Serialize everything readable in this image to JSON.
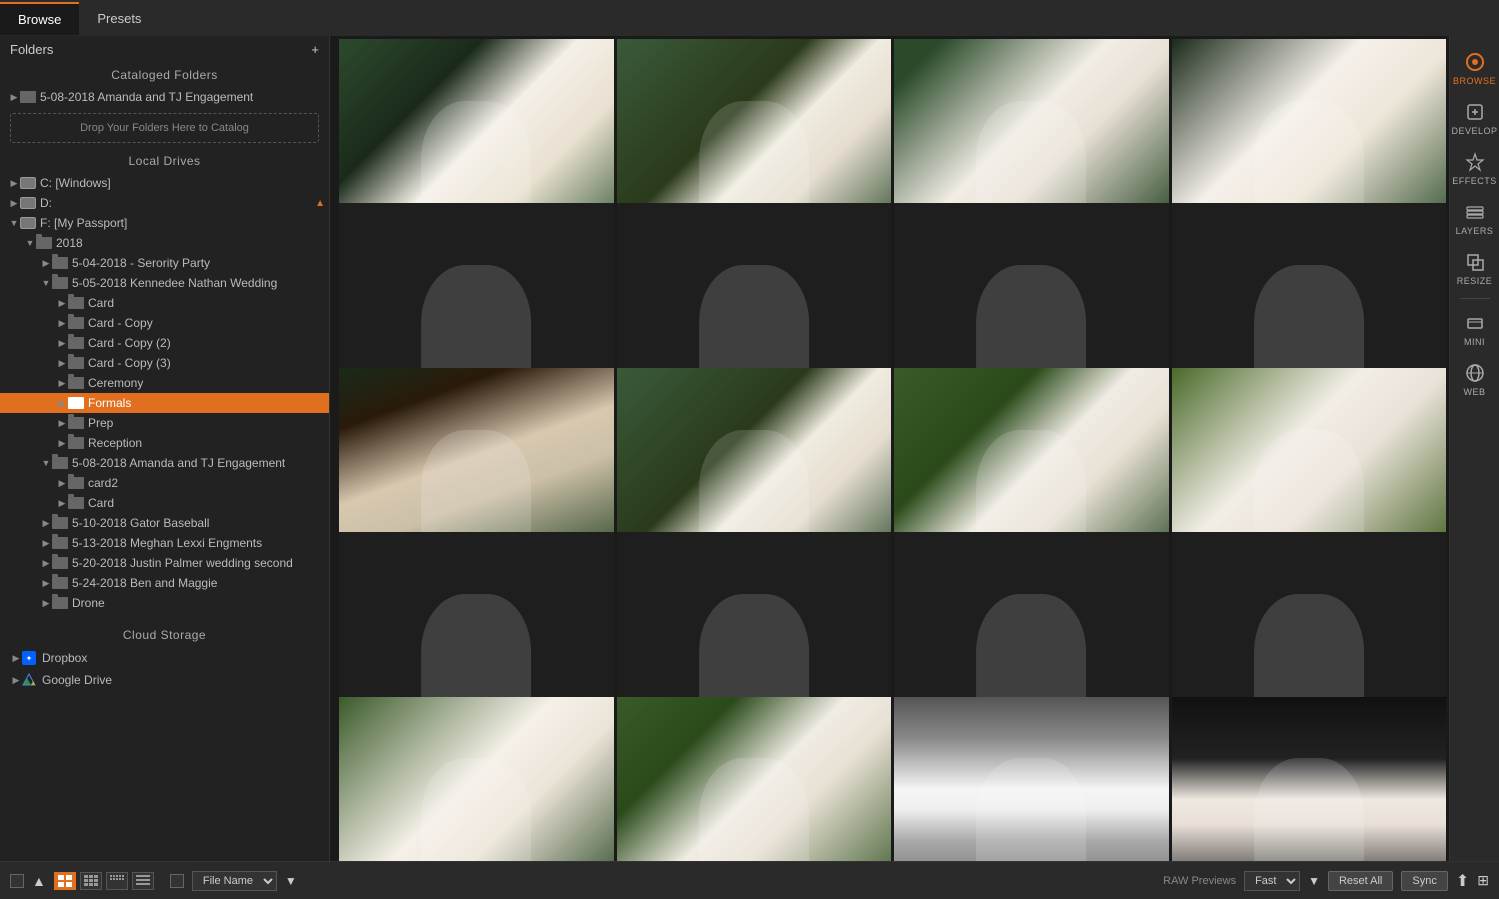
{
  "tabs": {
    "browse": "Browse",
    "presets": "Presets"
  },
  "sidebar": {
    "folders_label": "Folders",
    "cataloged_folders_label": "Cataloged Folders",
    "drop_zone_text": "Drop Your Folders Here to Catalog",
    "local_drives_label": "Local Drives",
    "cloud_storage_label": "Cloud Storage",
    "drives": [
      {
        "label": "C: [Windows]",
        "type": "hdd"
      },
      {
        "label": "D:",
        "type": "hdd",
        "eject": true
      },
      {
        "label": "F: [My Passport]",
        "type": "hdd",
        "expanded": true
      }
    ],
    "tree": [
      {
        "label": "5-08-2018 Amanda and TJ Engagement",
        "depth": 1,
        "type": "folder-cataloged"
      },
      {
        "label": "2018",
        "depth": 2,
        "type": "folder",
        "expanded": true
      },
      {
        "label": "5-04-2018 - Serority Party",
        "depth": 3,
        "type": "folder"
      },
      {
        "label": "5-05-2018 Kennedee Nathan Wedding",
        "depth": 3,
        "type": "folder",
        "expanded": true
      },
      {
        "label": "Card",
        "depth": 4,
        "type": "folder"
      },
      {
        "label": "Card - Copy",
        "depth": 4,
        "type": "folder"
      },
      {
        "label": "Card - Copy (2)",
        "depth": 4,
        "type": "folder"
      },
      {
        "label": "Card - Copy (3)",
        "depth": 4,
        "type": "folder"
      },
      {
        "label": "Ceremony",
        "depth": 4,
        "type": "folder"
      },
      {
        "label": "Formals",
        "depth": 4,
        "type": "folder",
        "active": true
      },
      {
        "label": "Prep",
        "depth": 4,
        "type": "folder"
      },
      {
        "label": "Reception",
        "depth": 4,
        "type": "folder"
      },
      {
        "label": "5-08-2018 Amanda and TJ Engagement",
        "depth": 3,
        "type": "folder",
        "expanded": true
      },
      {
        "label": "card2",
        "depth": 4,
        "type": "folder"
      },
      {
        "label": "Card",
        "depth": 4,
        "type": "folder"
      },
      {
        "label": "5-10-2018 Gator Baseball",
        "depth": 3,
        "type": "folder"
      },
      {
        "label": "5-13-2018 Meghan Lexxi Engments",
        "depth": 3,
        "type": "folder"
      },
      {
        "label": "5-20-2018 Justin Palmer wedding second",
        "depth": 3,
        "type": "folder"
      },
      {
        "label": "5-24-2018 Ben and Maggie",
        "depth": 3,
        "type": "folder"
      },
      {
        "label": "Drone",
        "depth": 3,
        "type": "folder"
      }
    ],
    "cloud_items": [
      {
        "label": "Dropbox",
        "type": "dropbox"
      },
      {
        "label": "Google Drive",
        "type": "gdrive"
      }
    ]
  },
  "right_panel": {
    "buttons": [
      {
        "label": "BROWSE",
        "active": true
      },
      {
        "label": "DEVELOP",
        "active": false
      },
      {
        "label": "EFFECTS",
        "active": false
      },
      {
        "label": "LAYERS",
        "active": false
      },
      {
        "label": "RESIZE",
        "active": false
      },
      {
        "label": "MINI",
        "active": false
      },
      {
        "label": "WEB",
        "active": false
      }
    ]
  },
  "bottom_bar": {
    "sort_label": "File Name",
    "raw_previews_label": "RAW Previews",
    "raw_speed": "Fast",
    "reset_label": "Reset All",
    "sync_label": "Sync"
  },
  "photos": [
    {
      "id": 1,
      "class": "photo-bride-1",
      "empty": false
    },
    {
      "id": 2,
      "class": "photo-bride-2",
      "empty": false
    },
    {
      "id": 3,
      "class": "photo-bride-3",
      "empty": false
    },
    {
      "id": 4,
      "class": "photo-bride-4",
      "empty": false
    },
    {
      "id": 5,
      "class": "empty",
      "empty": true
    },
    {
      "id": 6,
      "class": "empty",
      "empty": true
    },
    {
      "id": 7,
      "class": "empty",
      "empty": true
    },
    {
      "id": 8,
      "class": "empty",
      "empty": true
    },
    {
      "id": 9,
      "class": "photo-bride-1",
      "empty": false
    },
    {
      "id": 10,
      "class": "photo-bride-5",
      "empty": false
    },
    {
      "id": 11,
      "class": "photo-bride-2",
      "empty": false
    },
    {
      "id": 12,
      "class": "photo-bride-3",
      "empty": false
    },
    {
      "id": 13,
      "class": "empty",
      "empty": true
    },
    {
      "id": 14,
      "class": "empty",
      "empty": true
    },
    {
      "id": 15,
      "class": "empty",
      "empty": true
    },
    {
      "id": 16,
      "class": "empty",
      "empty": true
    },
    {
      "id": 17,
      "class": "photo-bride-6",
      "empty": false
    },
    {
      "id": 18,
      "class": "photo-bride-4",
      "empty": false
    },
    {
      "id": 19,
      "class": "photo-bride-7",
      "empty": false
    },
    {
      "id": 20,
      "class": "photo-bride-8",
      "empty": false
    }
  ]
}
